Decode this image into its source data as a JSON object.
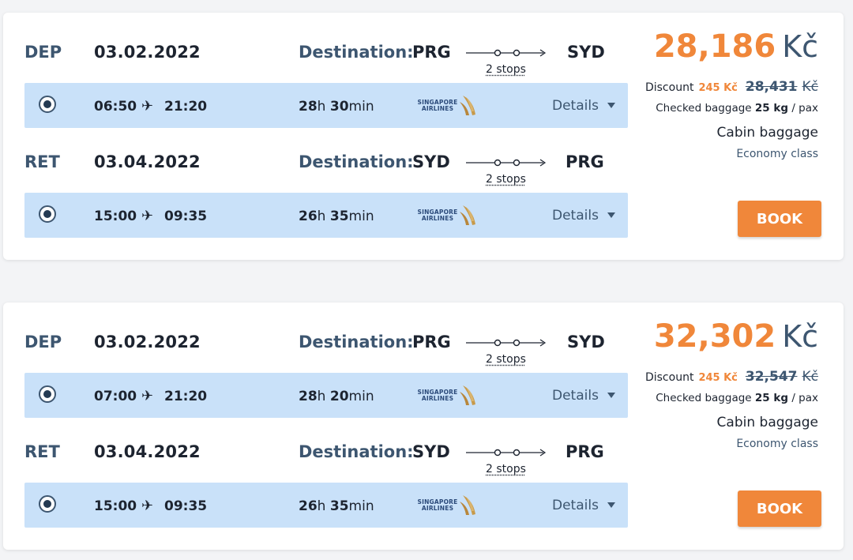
{
  "results": [
    {
      "legs": [
        {
          "type": "DEP",
          "date": "03.02.2022",
          "dest_label": "Destination:",
          "from": "PRG",
          "to": "SYD",
          "stops": "2 stops",
          "dep_time": "06:50",
          "arr_time": "21:20",
          "dur_h": "28",
          "dur_h_unit": "h",
          "dur_m": "30",
          "dur_m_unit": "min",
          "details": "Details"
        },
        {
          "type": "RET",
          "date": "03.04.2022",
          "dest_label": "Destination:",
          "from": "SYD",
          "to": "PRG",
          "stops": "2 stops",
          "dep_time": "15:00",
          "arr_time": "09:35",
          "dur_h": "26",
          "dur_h_unit": "h",
          "dur_m": "35",
          "dur_m_unit": "min",
          "details": "Details"
        }
      ],
      "price": "28,186",
      "currency": "Kč",
      "discount_label": "Discount",
      "discount_amount": "245 Kč",
      "old_price": "28,431",
      "old_currency": "Kč",
      "bag_label": "Checked baggage",
      "bag_weight": "25 kg",
      "bag_unit": "/ pax",
      "cabin": "Cabin baggage",
      "class": "Economy class",
      "book": "BOOK"
    },
    {
      "legs": [
        {
          "type": "DEP",
          "date": "03.02.2022",
          "dest_label": "Destination:",
          "from": "PRG",
          "to": "SYD",
          "stops": "2 stops",
          "dep_time": "07:00",
          "arr_time": "21:20",
          "dur_h": "28",
          "dur_h_unit": "h",
          "dur_m": "20",
          "dur_m_unit": "min",
          "details": "Details"
        },
        {
          "type": "RET",
          "date": "03.04.2022",
          "dest_label": "Destination:",
          "from": "SYD",
          "to": "PRG",
          "stops": "2 stops",
          "dep_time": "15:00",
          "arr_time": "09:35",
          "dur_h": "26",
          "dur_h_unit": "h",
          "dur_m": "35",
          "dur_m_unit": "min",
          "details": "Details"
        }
      ],
      "price": "32,302",
      "currency": "Kč",
      "discount_label": "Discount",
      "discount_amount": "245 Kč",
      "old_price": "32,547",
      "old_currency": "Kč",
      "bag_label": "Checked baggage",
      "bag_weight": "25 kg",
      "bag_unit": "/ pax",
      "cabin": "Cabin baggage",
      "class": "Economy class",
      "book": "BOOK"
    }
  ],
  "airline": {
    "name_line1": "SINGAPORE",
    "name_line2": "AIRLINES",
    "logo_icon": "singapore-airlines-bird-icon"
  },
  "icons": {
    "plane": "plane-icon",
    "radio": "radio-selected",
    "caret": "caret-down-icon",
    "route": "two-stop-route-icon"
  },
  "colors": {
    "accent": "#f0873a",
    "primary": "#3d5670",
    "segment_bg": "#c9e1f9"
  }
}
